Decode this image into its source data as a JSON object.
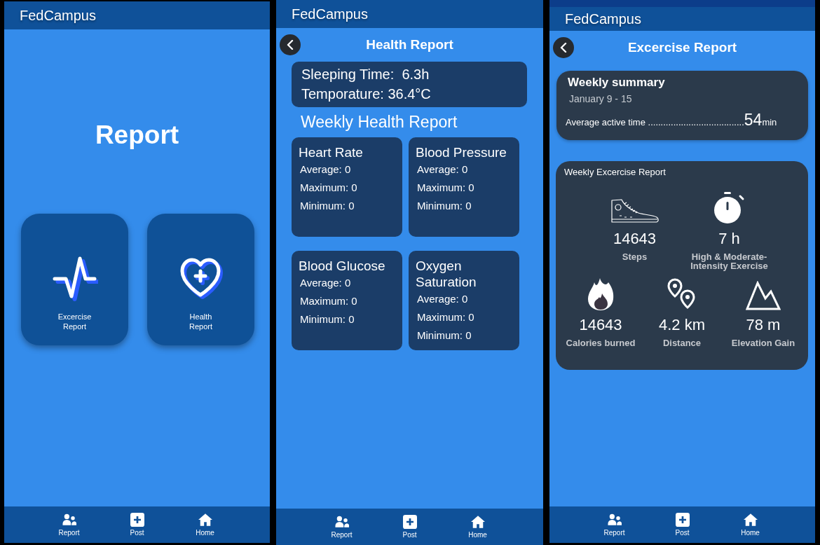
{
  "screens": [
    {
      "kind": "menu",
      "app_title": "FedCampus",
      "heading": "Report",
      "tiles": [
        {
          "kind": "pulse",
          "label": "Excercise Report"
        },
        {
          "kind": "heart",
          "label": "Health Report"
        }
      ],
      "nav": [
        {
          "kind": "people",
          "label": "Report"
        },
        {
          "kind": "plus",
          "label": "Post"
        },
        {
          "kind": "home",
          "label": "Home"
        }
      ]
    },
    {
      "kind": "health",
      "app_title": "FedCampus",
      "title": "Health Report",
      "summary": [
        "Sleeping Time:  6.3h",
        "Temporature: 36.4°C"
      ],
      "section_title": "Weekly Health Report",
      "metrics": [
        {
          "title": "Heart Rate",
          "lines": [
            "Average: 0",
            "Maximum: 0",
            "Minimum: 0"
          ]
        },
        {
          "title": "Blood Pressure",
          "lines": [
            "Average: 0",
            "Maximum: 0",
            "Minimum: 0"
          ]
        },
        {
          "title": "Blood Glucose",
          "lines": [
            "Average: 0",
            "Maximum: 0",
            "Minimum: 0"
          ]
        },
        {
          "title": "Oxygen Saturation",
          "lines": [
            "Average: 0",
            "Maximum: 0",
            "Minimum: 0"
          ]
        }
      ],
      "nav": [
        {
          "kind": "people",
          "label": "Report"
        },
        {
          "kind": "plus",
          "label": "Post"
        },
        {
          "kind": "home",
          "label": "Home"
        }
      ]
    },
    {
      "kind": "exercise",
      "app_title": "FedCampus",
      "title": "Excercise Report",
      "summary": {
        "title": "Weekly summary",
        "dates": "January 9 - 15",
        "label": "Average active time ......................................",
        "value": "54",
        "unit": "min"
      },
      "report": {
        "title": "Weekly Excercise Report",
        "rows": [
          [
            {
              "kind": "steps",
              "value": "14643",
              "label": "Steps"
            },
            {
              "kind": "timer",
              "value": "7 h",
              "label": "High & Moderate-Intensity Exercise"
            }
          ],
          [
            {
              "kind": "calories",
              "value": "14643",
              "label": "Calories burned"
            },
            {
              "kind": "distance",
              "value": "4.2 km",
              "label": "Distance"
            },
            {
              "kind": "elevation",
              "value": "78 m",
              "label": "Elevation Gain"
            }
          ]
        ]
      },
      "nav": [
        {
          "kind": "people",
          "label": "Report"
        },
        {
          "kind": "plus",
          "label": "Post"
        },
        {
          "kind": "home",
          "label": "Home"
        }
      ]
    }
  ]
}
